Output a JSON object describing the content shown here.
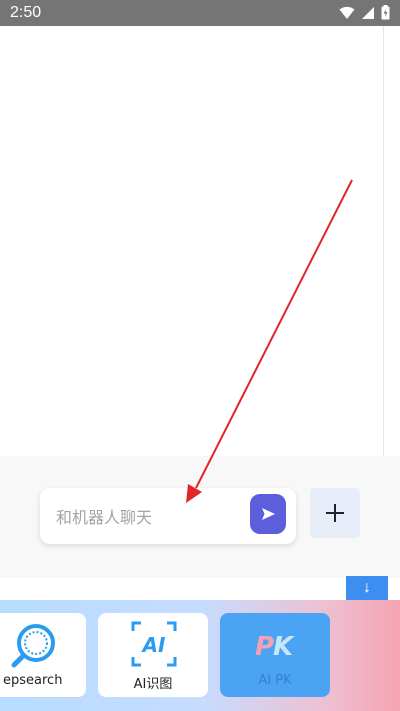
{
  "status_bar": {
    "time": "2:50"
  },
  "chat": {
    "input_placeholder": "和机器人聊天",
    "send_icon": "send-icon",
    "add_icon": "plus-icon"
  },
  "scroll_down": {
    "icon": "arrow-down-icon",
    "glyph": "↓"
  },
  "tools": [
    {
      "label": "epsearch",
      "icon": "deepsearch-icon"
    },
    {
      "label": "AI识图",
      "icon": "ai-recognize-icon"
    },
    {
      "label": "AI PK",
      "icon": "ai-pk-icon"
    }
  ],
  "annotation": {
    "arrow_color": "#e0262b"
  }
}
